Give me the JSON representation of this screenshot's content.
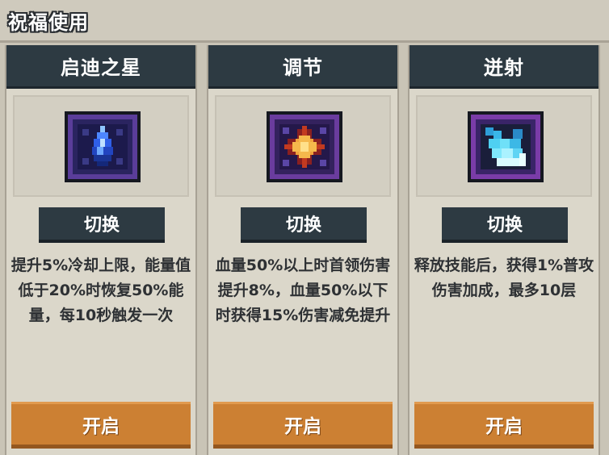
{
  "header": {
    "title": "祝福使用"
  },
  "cards": [
    {
      "title": "启迪之星",
      "icon": "blue-crystal-icon",
      "switch_label": "切换",
      "description": "提升5%冷却上限，能量值低于20%时恢复50%能量，每10秒触发一次",
      "open_label": "开启"
    },
    {
      "title": "调节",
      "icon": "orange-star-icon",
      "switch_label": "切换",
      "description": "血量50%以上时首领伤害提升8%，血量50%以下时获得15%伤害减免提升",
      "open_label": "开启"
    },
    {
      "title": "迸射",
      "icon": "cyan-burst-icon",
      "switch_label": "切换",
      "description": "释放技能后，获得1%普攻伤害加成，最多10层",
      "open_label": "开启"
    }
  ],
  "colors": {
    "panel_dark": "#2d3a42",
    "button_orange": "#cc8033",
    "background": "#c9c4b6"
  }
}
